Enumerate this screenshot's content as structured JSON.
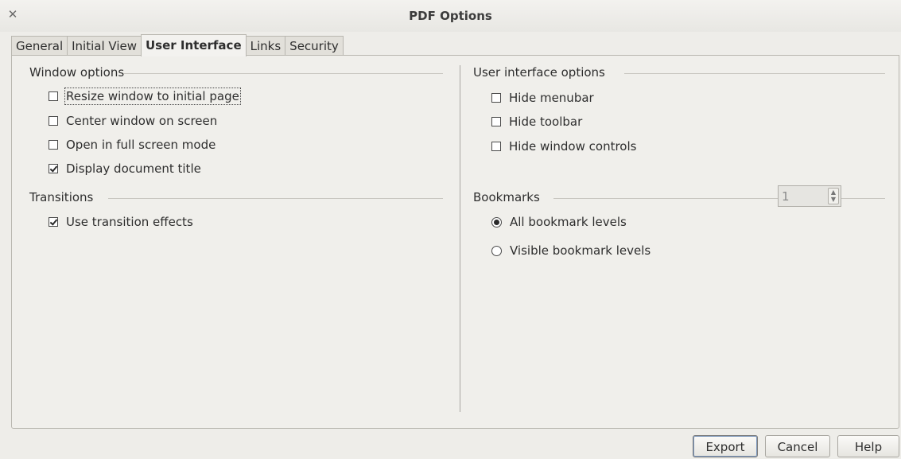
{
  "window": {
    "title": "PDF Options",
    "close_icon": "close-icon"
  },
  "tabs": [
    {
      "label": "General",
      "active": false
    },
    {
      "label": "Initial View",
      "active": false
    },
    {
      "label": "User Interface",
      "active": true
    },
    {
      "label": "Links",
      "active": false
    },
    {
      "label": "Security",
      "active": false
    }
  ],
  "window_options": {
    "title": "Window options",
    "items": [
      {
        "label": "Resize window to initial page",
        "checked": false
      },
      {
        "label": "Center window on screen",
        "checked": false
      },
      {
        "label": "Open in full screen mode",
        "checked": false
      },
      {
        "label": "Display document title",
        "checked": true
      }
    ]
  },
  "transitions": {
    "title": "Transitions",
    "items": [
      {
        "label": "Use transition effects",
        "checked": true
      }
    ]
  },
  "ui_options": {
    "title": "User interface options",
    "items": [
      {
        "label": "Hide menubar",
        "checked": false
      },
      {
        "label": "Hide toolbar",
        "checked": false
      },
      {
        "label": "Hide window controls",
        "checked": false
      }
    ]
  },
  "bookmarks": {
    "title": "Bookmarks",
    "items": [
      {
        "label": "All bookmark levels",
        "selected": true
      },
      {
        "label": "Visible bookmark levels",
        "selected": false
      }
    ],
    "level_value": "1"
  },
  "buttons": {
    "export": "Export",
    "cancel": "Cancel",
    "help": "Help"
  },
  "colors": {
    "background": "#eeede9",
    "border": "#b9b7b0",
    "default_button_ring": "#7d98bd"
  }
}
